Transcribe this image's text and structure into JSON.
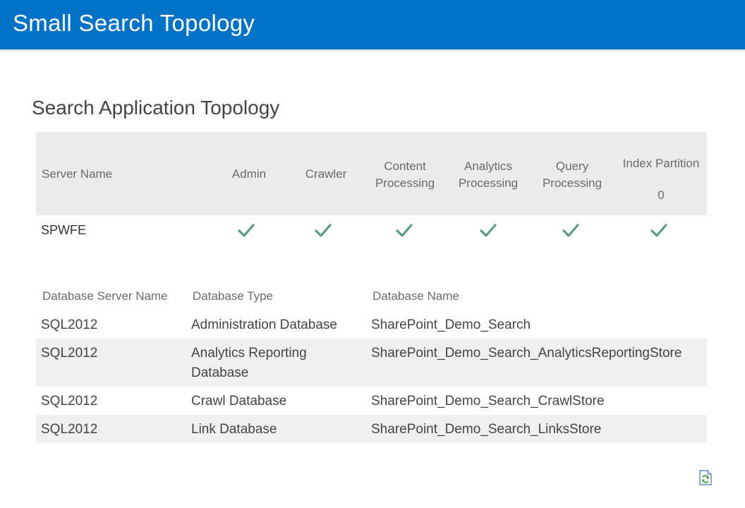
{
  "header": {
    "title": "Small Search Topology"
  },
  "section": {
    "title": "Search Application Topology"
  },
  "topology": {
    "columns": {
      "server_name": "Server Name",
      "admin": "Admin",
      "crawler": "Crawler",
      "content_processing": "Content\nProcessing",
      "analytics_processing": "Analytics\nProcessing",
      "query_processing": "Query\nProcessing",
      "index_partition": "Index Partition",
      "index_partition_number": "0"
    },
    "rows": [
      {
        "server": "SPWFE",
        "admin": true,
        "crawler": true,
        "content_processing": true,
        "analytics_processing": true,
        "query_processing": true,
        "index_partition": true
      }
    ],
    "check_color": "#5a9a7e",
    "check_icon": "checkmark-icon"
  },
  "databases": {
    "columns": {
      "server": "Database Server Name",
      "type": "Database Type",
      "name": "Database Name"
    },
    "rows": [
      {
        "server": "SQL2012",
        "type": "Administration Database",
        "name": "SharePoint_Demo_Search"
      },
      {
        "server": "SQL2012",
        "type": "Analytics Reporting\nDatabase",
        "name": "SharePoint_Demo_Search_AnalyticsReportingStore"
      },
      {
        "server": "SQL2012",
        "type": "Crawl Database",
        "name": "SharePoint_Demo_Search_CrawlStore"
      },
      {
        "server": "SQL2012",
        "type": "Link Database",
        "name": "SharePoint_Demo_Search_LinksStore"
      }
    ]
  },
  "colors": {
    "banner": "#0072c6",
    "header_bg": "#ebebeb",
    "alt_row_bg": "#efefef"
  },
  "refresh": {
    "icon": "refresh-document-icon"
  }
}
